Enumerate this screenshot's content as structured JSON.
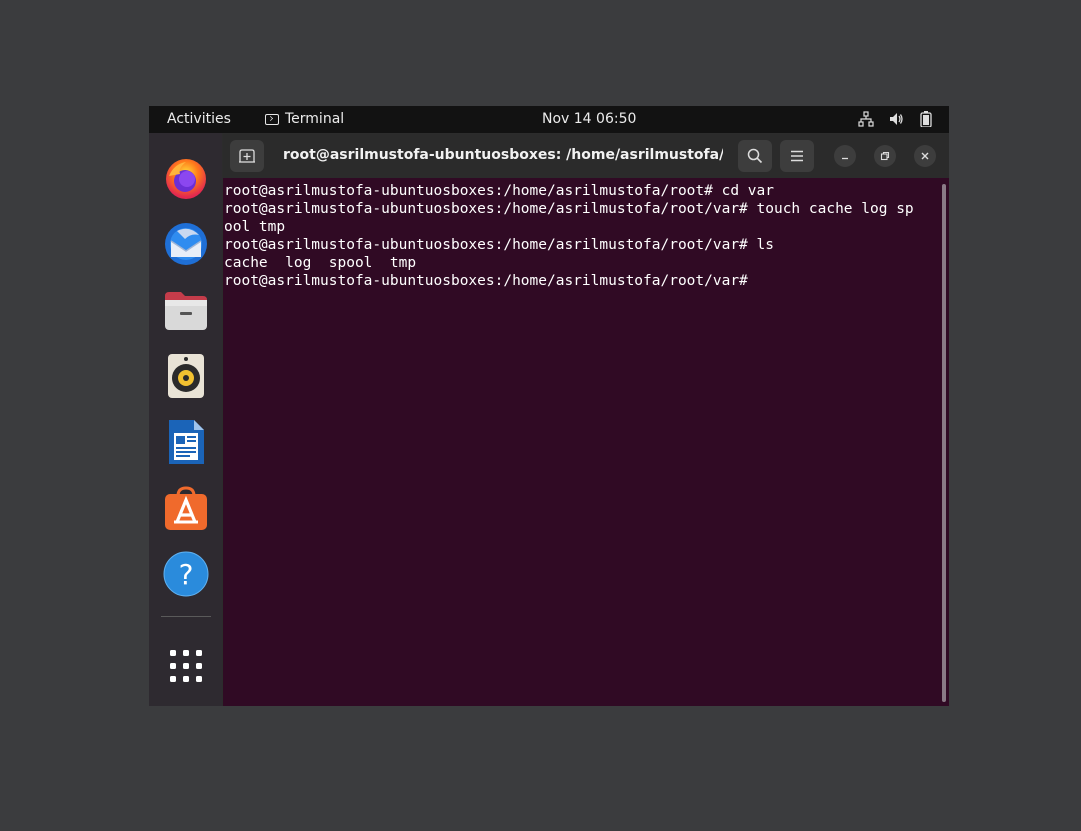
{
  "topbar": {
    "activities": "Activities",
    "app_name": "Terminal",
    "clock": "Nov 14  06:50",
    "tray_icons": [
      "network-icon",
      "volume-icon",
      "battery-icon"
    ]
  },
  "dock": {
    "apps": [
      "firefox",
      "thunderbird",
      "files",
      "rhythmbox",
      "libreoffice-writer",
      "ubuntu-software",
      "help",
      "show-applications"
    ]
  },
  "window": {
    "title": "root@asrilmustofa-ubuntuosboxes: /home/asrilmustofa/ro...",
    "background": "#300a24",
    "lines": [
      "root@asrilmustofa-ubuntuosboxes:/home/asrilmustofa/root# cd var",
      "root@asrilmustofa-ubuntuosboxes:/home/asrilmustofa/root/var# touch cache log sp",
      "ool tmp",
      "root@asrilmustofa-ubuntuosboxes:/home/asrilmustofa/root/var# ls",
      "cache  log  spool  tmp",
      "root@asrilmustofa-ubuntuosboxes:/home/asrilmustofa/root/var#"
    ]
  }
}
